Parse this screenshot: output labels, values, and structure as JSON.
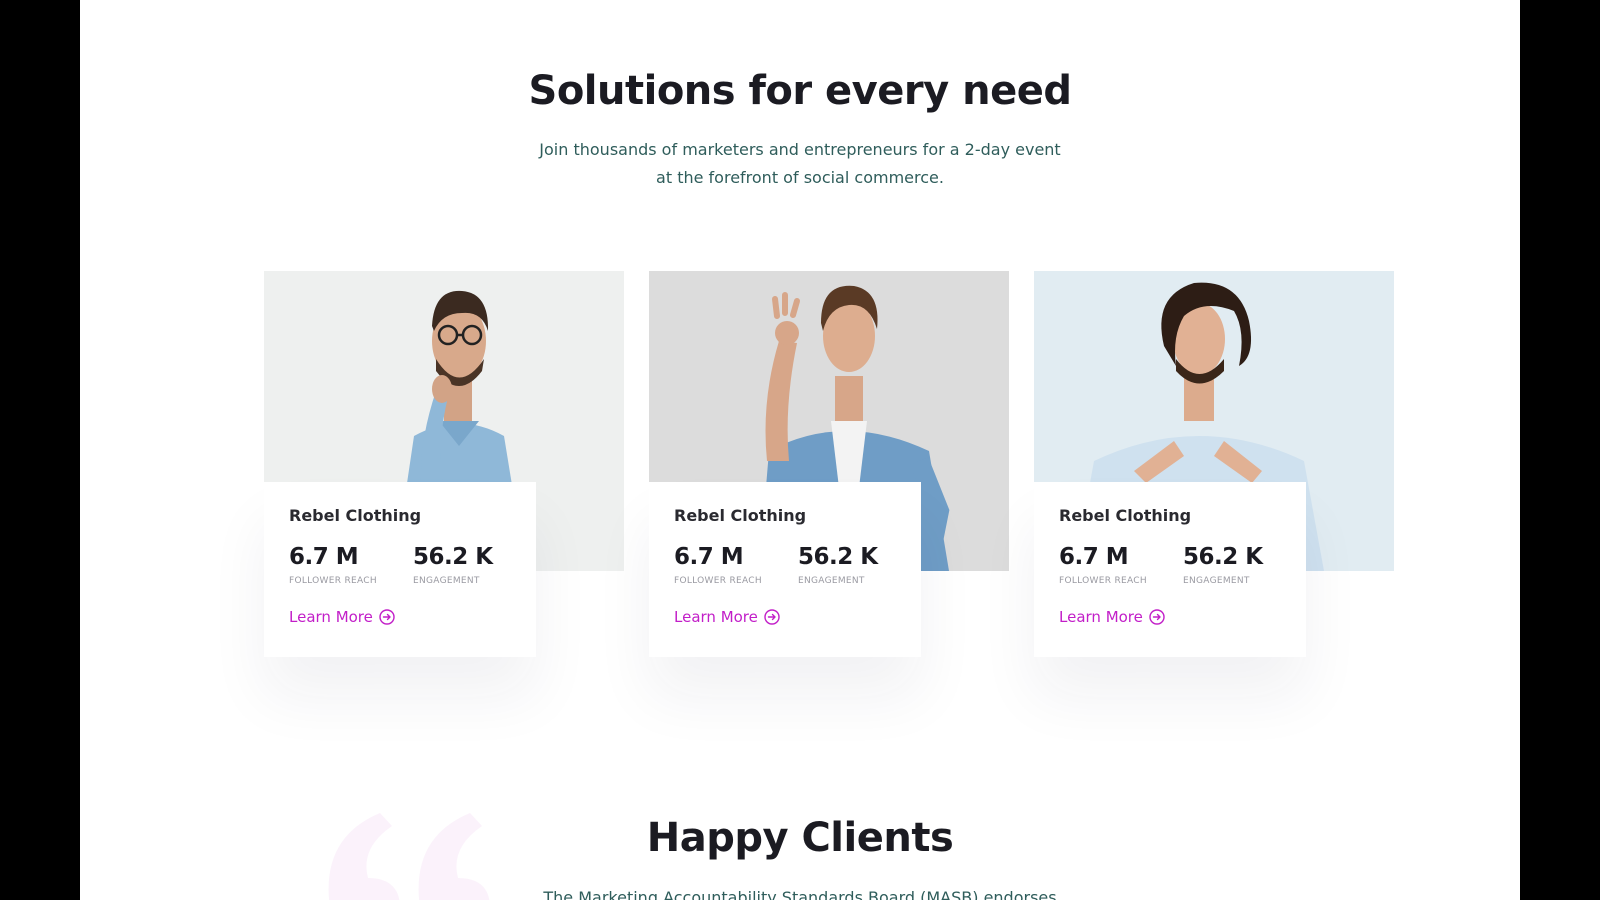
{
  "solutions": {
    "title": "Solutions for every need",
    "subtitle": "Join thousands of marketers and entrepreneurs for a 2-day event at the forefront of social commerce."
  },
  "cards": [
    {
      "brand": "Rebel Clothing",
      "reach": "6.7 M",
      "reach_label": "FOLLOWER REACH",
      "engagement": "56.2 K",
      "engagement_label": "ENGAGEMENT",
      "link": "Learn More"
    },
    {
      "brand": "Rebel Clothing",
      "reach": "6.7 M",
      "reach_label": "FOLLOWER REACH",
      "engagement": "56.2 K",
      "engagement_label": "ENGAGEMENT",
      "link": "Learn More"
    },
    {
      "brand": "Rebel Clothing",
      "reach": "6.7 M",
      "reach_label": "FOLLOWER REACH",
      "engagement": "56.2 K",
      "engagement_label": "ENGAGEMENT",
      "link": "Learn More"
    }
  ],
  "clients": {
    "title": "Happy Clients",
    "text": "The Marketing Accountability Standards Board (MASB) endorses the"
  },
  "colors": {
    "accent": "#c21ec8",
    "heading": "#1b1b22",
    "body_text": "#2f5d5b"
  }
}
